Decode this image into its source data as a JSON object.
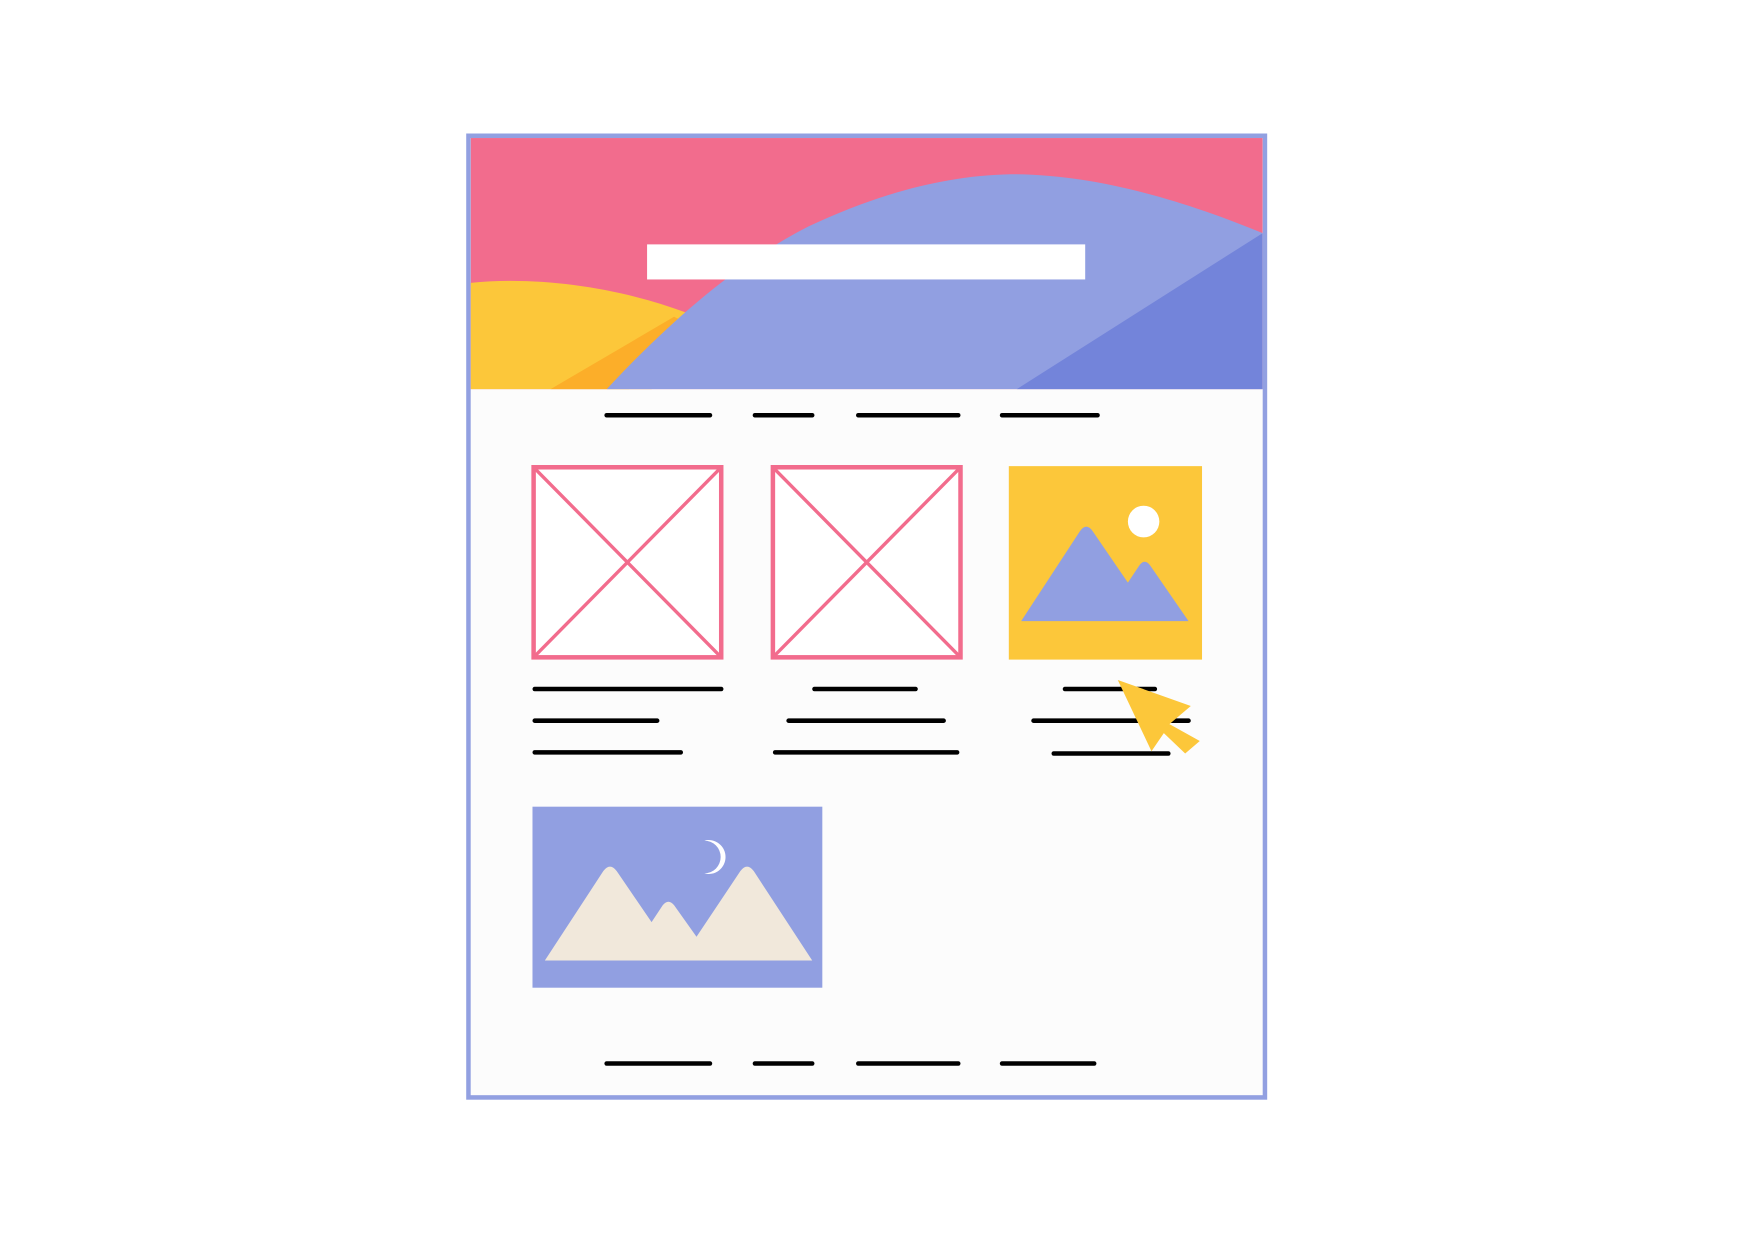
{
  "colors": {
    "background": "#ffffff",
    "page": "#fcfcfc",
    "frame_border": "#92a0e1",
    "hero_pink": "#f26c8d",
    "hero_lavender": "#919fe1",
    "hero_indigo": "#7384da",
    "hero_yellow": "#fcc73a",
    "hero_orange": "#fcae29",
    "title_bar": "#ffffff",
    "placeholder_stroke": "#f26c8d",
    "card_image_yellow": "#fcc73a",
    "card_image_mountain": "#919fe1",
    "feature_image_bg": "#919fe1",
    "feature_image_mountain": "#f1e8db",
    "cursor": "#fcc73a",
    "text_line": "#000000"
  },
  "wireframe": {
    "hero": {
      "title_placeholder": "white title bar"
    },
    "nav": {
      "item_count": 4
    },
    "cards": [
      {
        "kind": "placeholder-x",
        "text_lines": 3
      },
      {
        "kind": "placeholder-x",
        "text_lines": 3
      },
      {
        "kind": "image-mountain-sun",
        "text_lines": 3,
        "hovered": true
      }
    ],
    "feature_image": {
      "kind": "image-mountain-moon"
    },
    "footer_nav": {
      "item_count": 4
    },
    "cursor": {
      "icon": "arrow-cursor-icon"
    }
  }
}
